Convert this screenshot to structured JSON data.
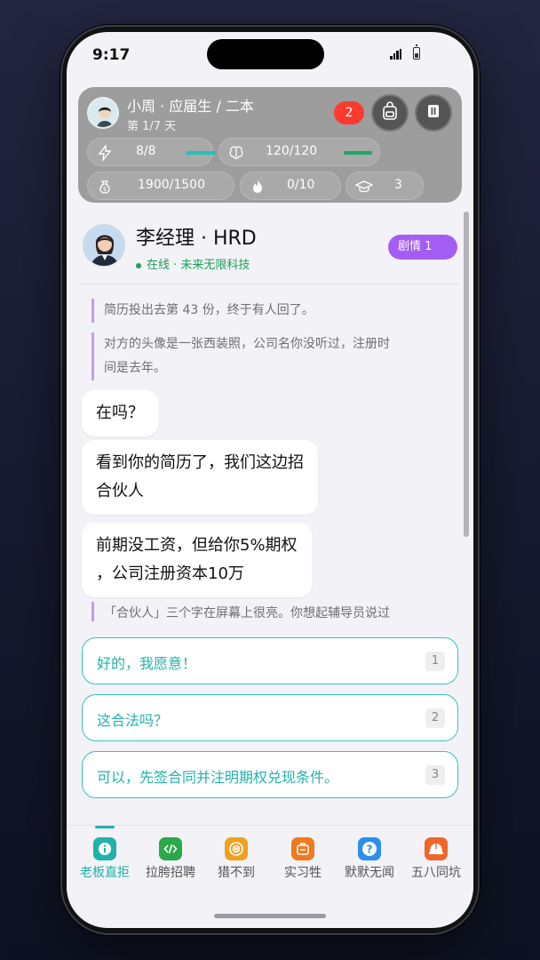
{
  "status_bar": {
    "time": "9:17"
  },
  "player": {
    "name": "小周 · 应届生 / 二本",
    "day": "第 1/7 天",
    "notification_count": "2",
    "stats": [
      {
        "icon": "lightning-icon",
        "value": "8/8",
        "fill": 1.0,
        "color": "#20c1b8"
      },
      {
        "icon": "brain-icon",
        "value": "120/120",
        "fill": 1.0,
        "color": "#1ba765"
      },
      {
        "icon": "money-bag-icon",
        "value": "1900/1500"
      },
      {
        "icon": "flame-icon",
        "value": "0/10"
      },
      {
        "icon": "graduation-cap-icon",
        "value": "3"
      }
    ]
  },
  "contact": {
    "name": "李经理 · HRD",
    "status": "在线 · 未来无限科技",
    "plot_tag": "剧情 1"
  },
  "messages": [
    {
      "type": "narration",
      "text": "简历投出去第 43 份，终于有人回了。"
    },
    {
      "type": "narration",
      "lines": [
        "对方的头像是一张西装照，公司名你没听过，注册时",
        "间是去年。"
      ]
    },
    {
      "type": "bubble",
      "lines": [
        "在吗？"
      ]
    },
    {
      "type": "bubble",
      "lines": [
        "看到你的简历了，我们这边招",
        "合伙人"
      ]
    },
    {
      "type": "bubble",
      "lines": [
        "前期没工资，但给你5%期权",
        "，公司注册资本10万"
      ]
    },
    {
      "type": "narration",
      "text": "「合伙人」三个字在屏幕上很亮。你想起辅导员说过"
    }
  ],
  "choices": [
    {
      "text": "好的，我愿意！",
      "key": "1"
    },
    {
      "text": "这合法吗？",
      "key": "2"
    },
    {
      "text": "可以，先签合同并注明期权兑现条件。",
      "key": "3"
    }
  ],
  "tabs": [
    {
      "label": "老板直拒",
      "icon": "info-icon",
      "color": "#20b2aa",
      "active": true
    },
    {
      "label": "拉胯招聘",
      "icon": "code-icon",
      "color": "#2aa84a"
    },
    {
      "label": "猎不到",
      "icon": "target-icon",
      "color": "#f0a020"
    },
    {
      "label": "实习牲",
      "icon": "badge-icon",
      "color": "#f07a20"
    },
    {
      "label": "默默无闻",
      "icon": "question-icon",
      "color": "#2b8ef0"
    },
    {
      "label": "五八同坑",
      "icon": "helmet-icon",
      "color": "#f0662a"
    }
  ]
}
